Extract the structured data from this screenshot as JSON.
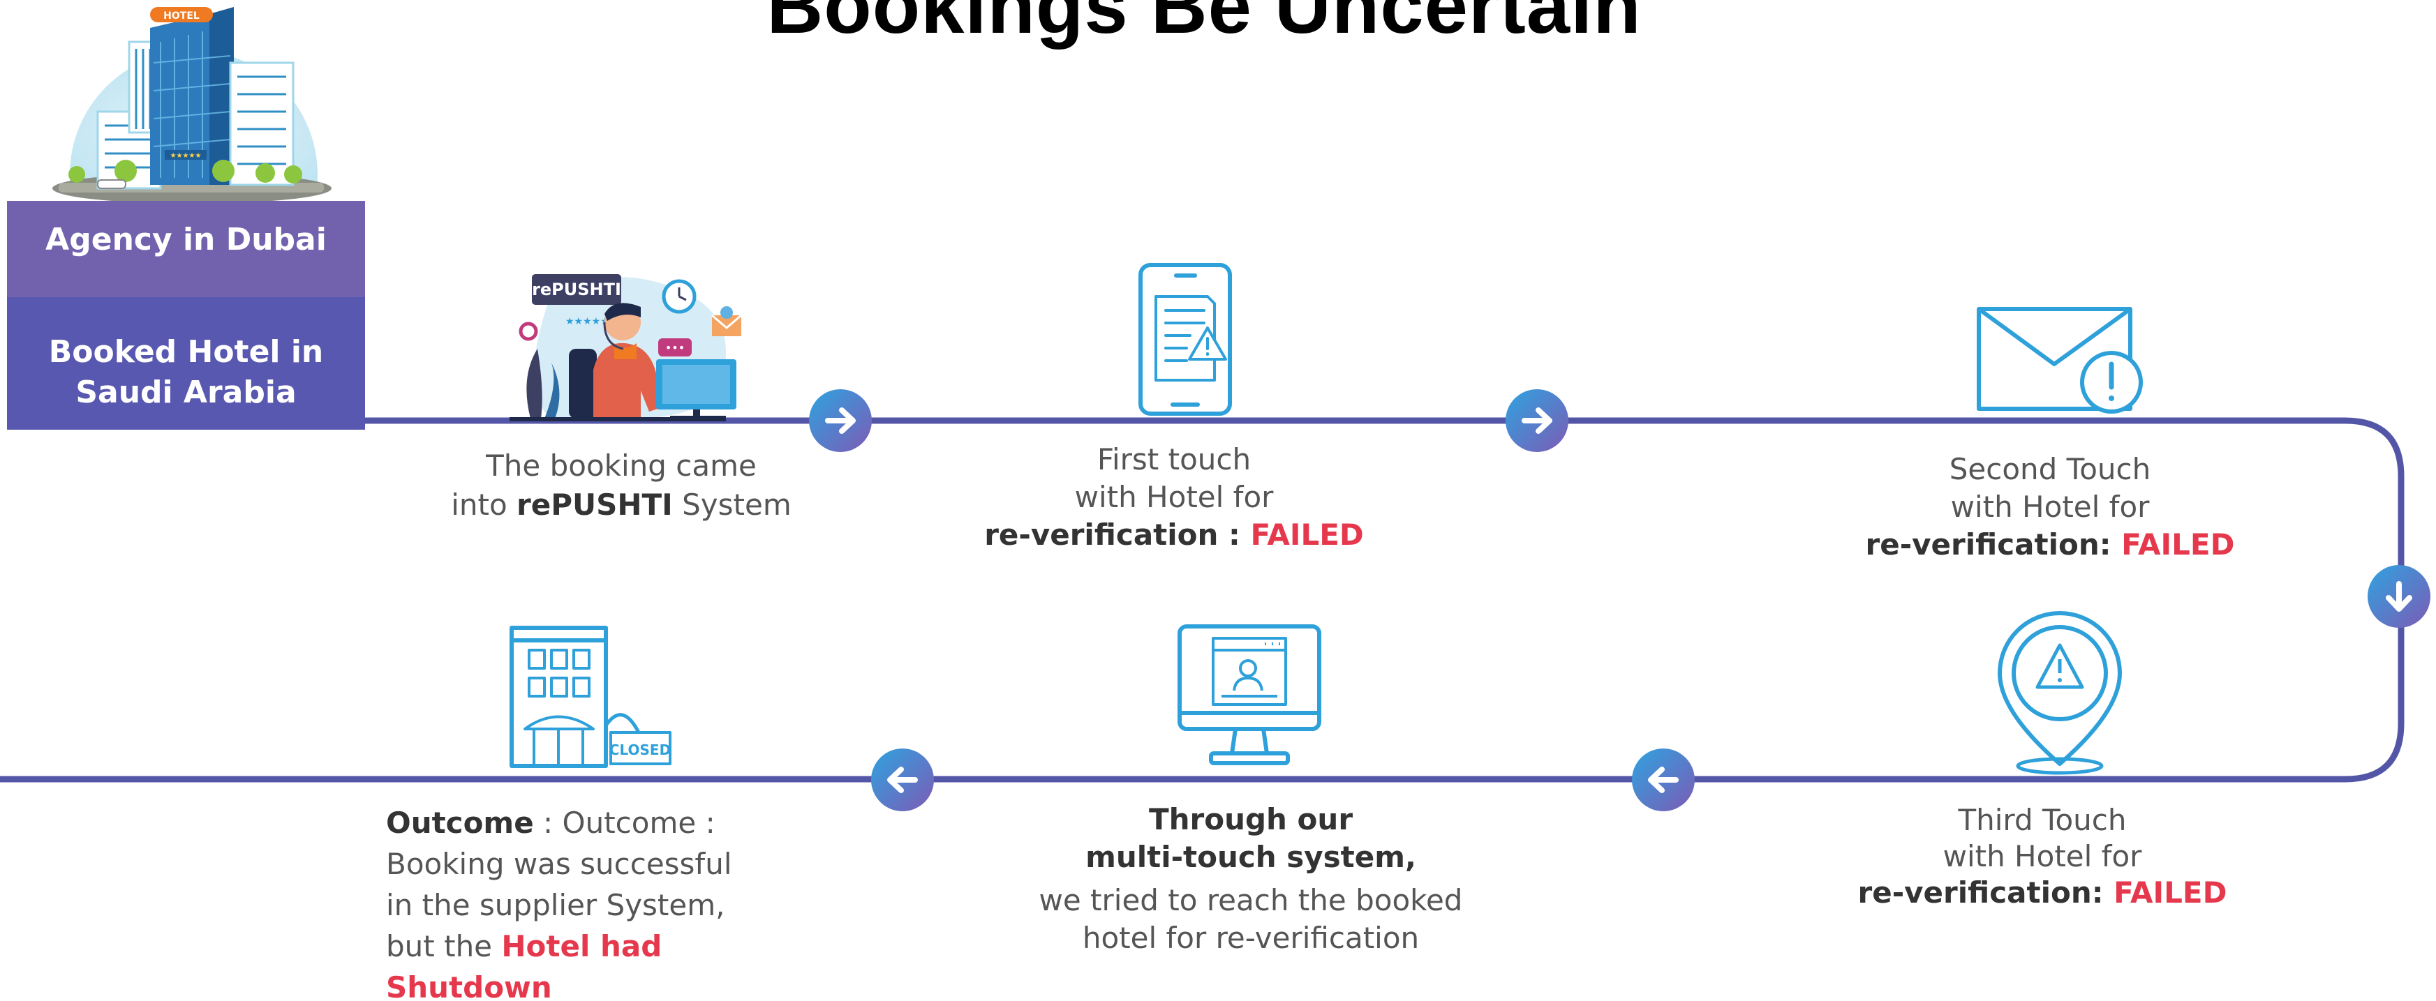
{
  "title": "Bookings Be Uncertain",
  "agency": {
    "line1": "Agency in Dubai",
    "line2": "Booked Hotel in Saudi Arabia"
  },
  "steps": {
    "s1": {
      "pre": "The booking came",
      "pre2": "into ",
      "brand": "rePUSHTI",
      "post": " System"
    },
    "s2": {
      "l1": "First touch",
      "l2": "with Hotel for",
      "bold": "re-verification : ",
      "status": "FAILED"
    },
    "s3": {
      "l1": "Second Touch",
      "l2": "with Hotel for",
      "bold": "re-verification: ",
      "status": "FAILED"
    },
    "s4": {
      "l1": "Third Touch",
      "l2": "with Hotel for",
      "bold": "re-verification: ",
      "status": "FAILED"
    },
    "s5": {
      "b1": "Through our",
      "b2": "multi-touch system,",
      "l1": "we tried to reach the booked",
      "l2": "hotel for re-verification"
    },
    "s6": {
      "bold": "Outcome",
      "l1": " : Outcome :",
      "l2": "Booking was successful",
      "l3": "in the supplier System,",
      "l4": "but the ",
      "red1": "Hotel had",
      "red2": "Shutdown"
    }
  },
  "illustration": {
    "hotel_sign": "HOTEL",
    "brand_sign": "rePUSHTI",
    "closed_sign": "CLOSED"
  },
  "colors": {
    "flow_line": "#5356a6",
    "accent_blue": "#2ea0da",
    "arrow_gradient_start": "#2ea3e0",
    "arrow_gradient_end": "#7d5bb5",
    "failed_red": "#e6384c",
    "agency_top": "#7262ad",
    "agency_bottom": "#5858b0"
  },
  "icons": [
    "hotel-building-icon",
    "swap-arrows-icon",
    "support-agent-icon",
    "smartphone-document-warning-icon",
    "envelope-alert-icon",
    "location-pin-warning-icon",
    "monitor-profile-icon",
    "closed-hotel-icon",
    "arrow-right-icon",
    "arrow-down-icon",
    "arrow-left-icon"
  ]
}
